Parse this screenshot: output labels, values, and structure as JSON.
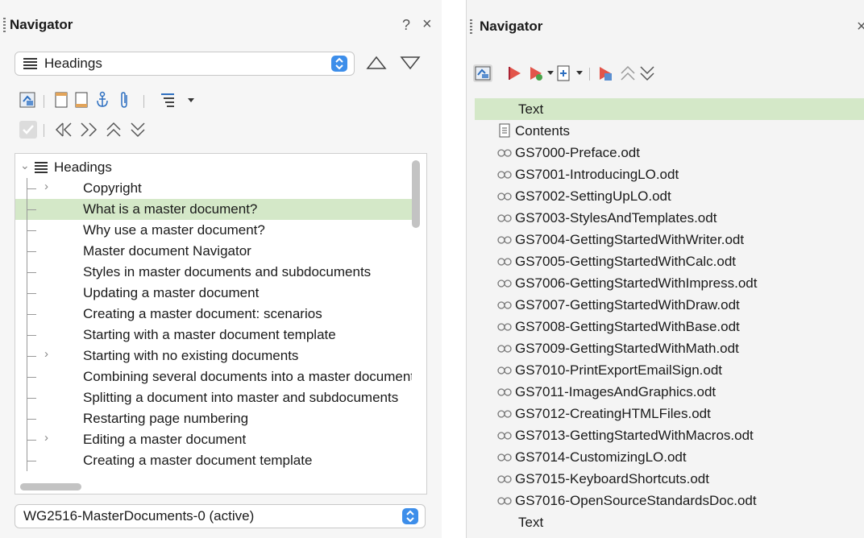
{
  "left": {
    "title": "Navigator",
    "help": "?",
    "close": "×",
    "content_type": "Headings",
    "tree_root": "Headings",
    "headings": [
      {
        "label": "Copyright",
        "expandable": true,
        "selected": false
      },
      {
        "label": "What is a master document?",
        "expandable": false,
        "selected": true
      },
      {
        "label": "Why use a master document?",
        "expandable": false,
        "selected": false
      },
      {
        "label": "Master document Navigator",
        "expandable": false,
        "selected": false
      },
      {
        "label": "Styles in master documents and subdocuments",
        "expandable": false,
        "selected": false
      },
      {
        "label": "Updating a master document",
        "expandable": false,
        "selected": false
      },
      {
        "label": "Creating a master document: scenarios",
        "expandable": false,
        "selected": false
      },
      {
        "label": "Starting with a master document template",
        "expandable": false,
        "selected": false
      },
      {
        "label": "Starting with no existing documents",
        "expandable": true,
        "selected": false
      },
      {
        "label": "Combining several documents into a master document",
        "expandable": false,
        "selected": false
      },
      {
        "label": "Splitting a document into master and subdocuments",
        "expandable": false,
        "selected": false
      },
      {
        "label": "Restarting page numbering",
        "expandable": false,
        "selected": false
      },
      {
        "label": "Editing a master document",
        "expandable": true,
        "selected": false
      },
      {
        "label": "Creating a master document template",
        "expandable": false,
        "selected": false
      }
    ],
    "document_select": "WG2516-MasterDocuments-0 (active)",
    "accent": "#3d8eea",
    "selection_color": "#d4e8c8"
  },
  "right": {
    "title": "Navigator",
    "close": "×",
    "items": [
      {
        "label": "Text",
        "type": "text",
        "selected": true
      },
      {
        "label": "Contents",
        "type": "index",
        "selected": false
      },
      {
        "label": "GS7000-Preface.odt",
        "type": "link",
        "selected": false
      },
      {
        "label": "GS7001-IntroducingLO.odt",
        "type": "link",
        "selected": false
      },
      {
        "label": "GS7002-SettingUpLO.odt",
        "type": "link",
        "selected": false
      },
      {
        "label": "GS7003-StylesAndTemplates.odt",
        "type": "link",
        "selected": false
      },
      {
        "label": "GS7004-GettingStartedWithWriter.odt",
        "type": "link",
        "selected": false
      },
      {
        "label": "GS7005-GettingStartedWithCalc.odt",
        "type": "link",
        "selected": false
      },
      {
        "label": "GS7006-GettingStartedWithImpress.odt",
        "type": "link",
        "selected": false
      },
      {
        "label": "GS7007-GettingStartedWithDraw.odt",
        "type": "link",
        "selected": false
      },
      {
        "label": "GS7008-GettingStartedWithBase.odt",
        "type": "link",
        "selected": false
      },
      {
        "label": "GS7009-GettingStartedWithMath.odt",
        "type": "link",
        "selected": false
      },
      {
        "label": "GS7010-PrintExportEmailSign.odt",
        "type": "link",
        "selected": false
      },
      {
        "label": "GS7011-ImagesAndGraphics.odt",
        "type": "link",
        "selected": false
      },
      {
        "label": "GS7012-CreatingHTMLFiles.odt",
        "type": "link",
        "selected": false
      },
      {
        "label": "GS7013-GettingStartedWithMacros.odt",
        "type": "link",
        "selected": false
      },
      {
        "label": "GS7014-CustomizingLO.odt",
        "type": "link",
        "selected": false
      },
      {
        "label": "GS7015-KeyboardShortcuts.odt",
        "type": "link",
        "selected": false
      },
      {
        "label": "GS7016-OpenSourceStandardsDoc.odt",
        "type": "link",
        "selected": false
      },
      {
        "label": "Text",
        "type": "text",
        "selected": false
      }
    ]
  }
}
